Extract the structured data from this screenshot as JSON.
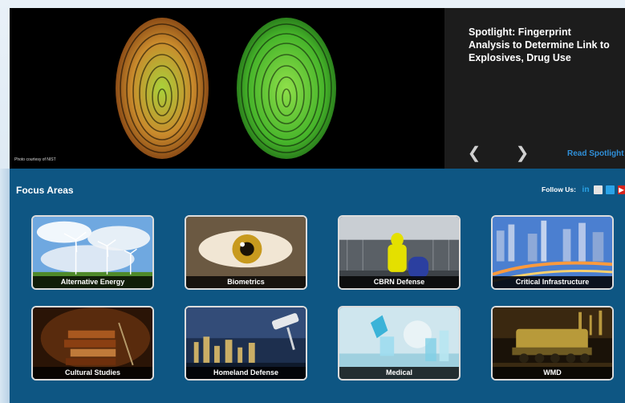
{
  "spotlight": {
    "title": "Spotlight: Fingerprint Analysis to Determine Link to Explosives, Drug Use",
    "photo_credit": "Photo courtesy of NIST",
    "prev_icon": "chevron-left-icon",
    "next_icon": "chevron-right-icon",
    "prev_glyph": "❮",
    "next_glyph": "❯",
    "read_link": "Read Spotlight"
  },
  "focus": {
    "title": "Focus Areas",
    "follow_label": "Follow Us:",
    "social": [
      {
        "name": "linkedin-icon",
        "glyph": "in"
      },
      {
        "name": "rss-icon",
        "glyph": ""
      },
      {
        "name": "twitter-icon",
        "glyph": ""
      },
      {
        "name": "youtube-icon",
        "glyph": "▶"
      }
    ],
    "tiles": [
      {
        "label": "Alternative Energy",
        "image": "wind-turbines"
      },
      {
        "label": "Biometrics",
        "image": "eye"
      },
      {
        "label": "CBRN Defense",
        "image": "hazmat-suit"
      },
      {
        "label": "Critical Infrastructure",
        "image": "city-highway"
      },
      {
        "label": "Cultural Studies",
        "image": "books"
      },
      {
        "label": "Homeland Defense",
        "image": "security-camera"
      },
      {
        "label": "Medical",
        "image": "lab-equipment"
      },
      {
        "label": "WMD",
        "image": "missile-launcher"
      }
    ]
  },
  "colors": {
    "focus_bg": "#0e5683",
    "link": "#2f8fd8",
    "hero_panel": "#1c1c1c"
  }
}
